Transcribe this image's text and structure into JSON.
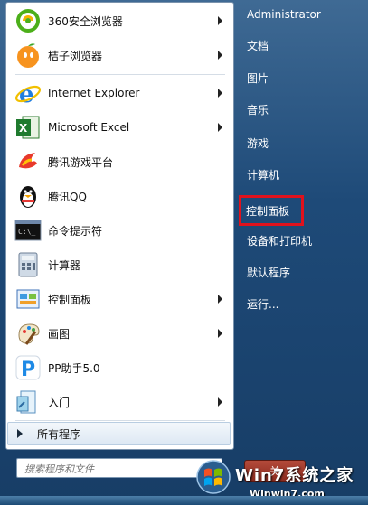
{
  "programs": [
    {
      "label": "360安全浏览器",
      "icon": "browser-360-icon",
      "submenu": true
    },
    {
      "label": "桔子浏览器",
      "icon": "orange-browser-icon",
      "submenu": true
    },
    {
      "label": "Internet Explorer",
      "icon": "internet-explorer-icon",
      "submenu": true
    },
    {
      "label": "Microsoft Excel",
      "icon": "excel-icon",
      "submenu": true
    },
    {
      "label": "腾讯游戏平台",
      "icon": "tencent-games-icon",
      "submenu": false
    },
    {
      "label": "腾讯QQ",
      "icon": "qq-penguin-icon",
      "submenu": false
    },
    {
      "label": "命令提示符",
      "icon": "command-prompt-icon",
      "submenu": false
    },
    {
      "label": "计算器",
      "icon": "calculator-icon",
      "submenu": false
    },
    {
      "label": "控制面板",
      "icon": "control-panel-icon",
      "submenu": true
    },
    {
      "label": "画图",
      "icon": "paint-icon",
      "submenu": true
    },
    {
      "label": "PP助手5.0",
      "icon": "pp-assistant-icon",
      "submenu": false
    },
    {
      "label": "入门",
      "icon": "getting-started-icon",
      "submenu": true
    }
  ],
  "all_programs_label": "所有程序",
  "search": {
    "placeholder": "搜索程序和文件"
  },
  "right_panel": {
    "user": "Administrator",
    "items": [
      "文档",
      "图片",
      "音乐",
      "游戏",
      "计算机",
      "控制面板",
      "设备和打印机",
      "默认程序",
      "运行..."
    ]
  },
  "shutdown_label": "关",
  "watermark": {
    "brand": "Win7系统之家",
    "url": "Winwin7.com"
  },
  "colors": {
    "highlight": "#e0121d",
    "panel": "#1e4a78"
  }
}
